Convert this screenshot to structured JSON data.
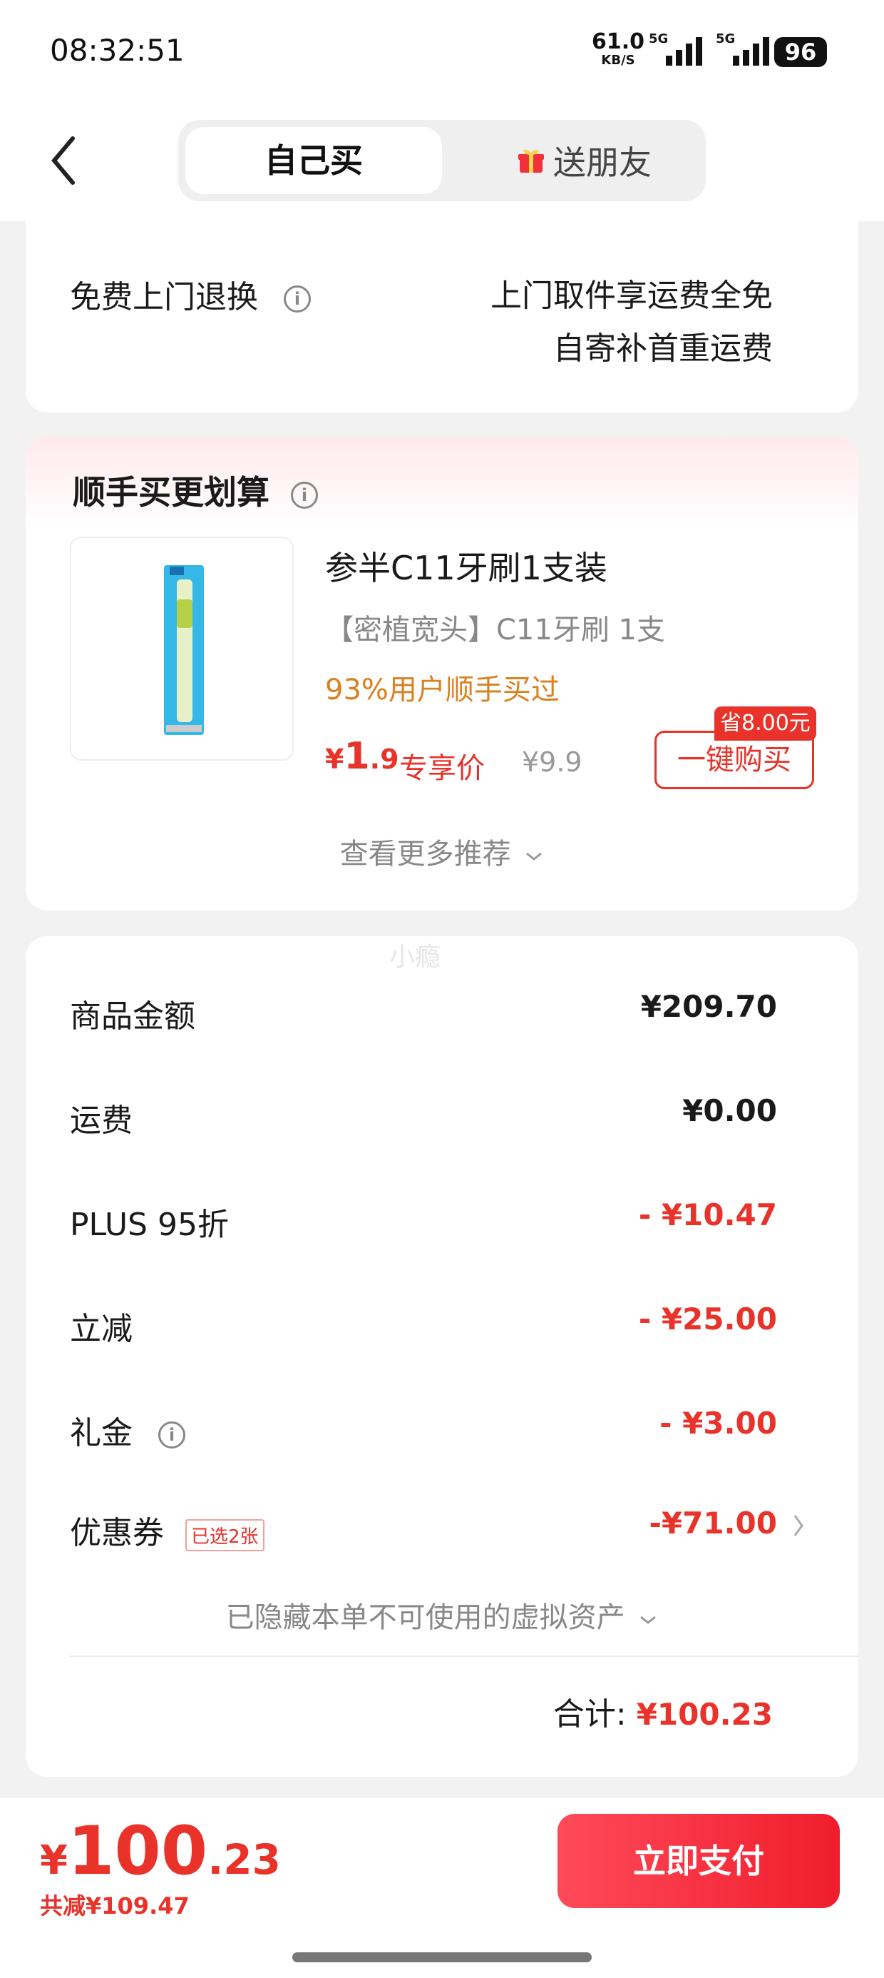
{
  "status_bar": {
    "time": "08:32:51",
    "net_speed": "61.0",
    "net_unit": "KB/S",
    "signal1_label": "5G",
    "signal2_label": "5G",
    "battery": "96"
  },
  "header": {
    "tab_self": "自己买",
    "tab_gift": "送朋友"
  },
  "return_card": {
    "label": "免费上门退换",
    "line1": "上门取件享运费全免",
    "line2": "自寄补首重运费"
  },
  "recommend": {
    "title": "顺手买更划算",
    "product_name": "参半C11牙刷1支装",
    "product_sub": "【密植宽头】C11牙刷 1支",
    "stat": "93%用户顺手买过",
    "price_symbol": "¥",
    "price_int": "1",
    "price_dec": ".9",
    "price_tag": "专享价",
    "orig_price": "¥9.9",
    "save_badge": "省8.00元",
    "buy_button": "一键购买",
    "more": "查看更多推荐"
  },
  "summary": {
    "watermark": "小瘾",
    "rows": [
      {
        "label": "商品金额",
        "value": "¥209.70"
      },
      {
        "label": "运费",
        "value": "¥0.00"
      },
      {
        "label": "PLUS 95折",
        "value": "- ¥10.47"
      },
      {
        "label": "立减",
        "value": "- ¥25.00"
      },
      {
        "label": "礼金",
        "value": "- ¥3.00"
      },
      {
        "label": "优惠券",
        "value": "-¥71.00"
      }
    ],
    "coupon_tag": "已选2张",
    "hidden_note": "已隐藏本单不可使用的虚拟资产",
    "total_label": "合计:",
    "total_value": "¥100.23"
  },
  "bottom_bar": {
    "symbol": "¥",
    "amount_int": "100",
    "amount_dec": ".23",
    "saved": "共减¥109.47",
    "pay_button": "立即支付"
  },
  "colors": {
    "accent": "#e8322a",
    "orange": "#d9801f",
    "bg": "#f2f2f2"
  }
}
